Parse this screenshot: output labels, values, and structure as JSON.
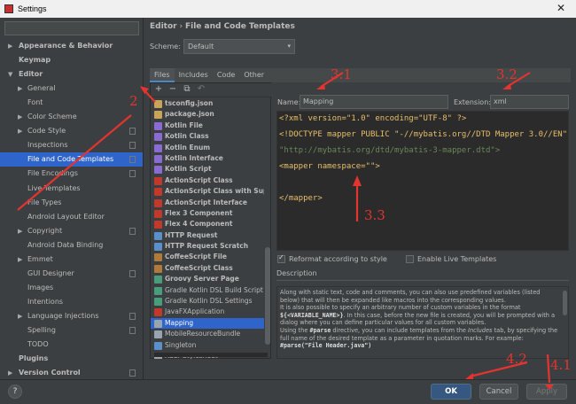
{
  "window": {
    "title": "Settings",
    "close_glyph": "✕"
  },
  "sidebar": {
    "items": [
      {
        "label": "Appearance & Behavior",
        "arrow": "▶",
        "bold": true,
        "indent": 0
      },
      {
        "label": "Keymap",
        "arrow": "",
        "bold": true,
        "indent": 0
      },
      {
        "label": "Editor",
        "arrow": "▼",
        "bold": true,
        "indent": 0
      },
      {
        "label": "General",
        "arrow": "▶",
        "bold": false,
        "indent": 1
      },
      {
        "label": "Font",
        "arrow": "",
        "bold": false,
        "indent": 1
      },
      {
        "label": "Color Scheme",
        "arrow": "▶",
        "bold": false,
        "indent": 1
      },
      {
        "label": "Code Style",
        "arrow": "▶",
        "bold": false,
        "indent": 1,
        "copy": true
      },
      {
        "label": "Inspections",
        "arrow": "",
        "bold": false,
        "indent": 1,
        "copy": true
      },
      {
        "label": "File and Code Templates",
        "arrow": "",
        "bold": false,
        "indent": 1,
        "copy": true,
        "selected": true
      },
      {
        "label": "File Encodings",
        "arrow": "",
        "bold": false,
        "indent": 1,
        "copy": true
      },
      {
        "label": "Live Templates",
        "arrow": "",
        "bold": false,
        "indent": 1
      },
      {
        "label": "File Types",
        "arrow": "",
        "bold": false,
        "indent": 1
      },
      {
        "label": "Android Layout Editor",
        "arrow": "",
        "bold": false,
        "indent": 1
      },
      {
        "label": "Copyright",
        "arrow": "▶",
        "bold": false,
        "indent": 1,
        "copy": true
      },
      {
        "label": "Android Data Binding",
        "arrow": "",
        "bold": false,
        "indent": 1
      },
      {
        "label": "Emmet",
        "arrow": "▶",
        "bold": false,
        "indent": 1
      },
      {
        "label": "GUI Designer",
        "arrow": "",
        "bold": false,
        "indent": 1,
        "copy": true
      },
      {
        "label": "Images",
        "arrow": "",
        "bold": false,
        "indent": 1
      },
      {
        "label": "Intentions",
        "arrow": "",
        "bold": false,
        "indent": 1
      },
      {
        "label": "Language Injections",
        "arrow": "▶",
        "bold": false,
        "indent": 1,
        "copy": true
      },
      {
        "label": "Spelling",
        "arrow": "",
        "bold": false,
        "indent": 1,
        "copy": true
      },
      {
        "label": "TODO",
        "arrow": "",
        "bold": false,
        "indent": 1
      },
      {
        "label": "Plugins",
        "arrow": "",
        "bold": true,
        "indent": 0
      },
      {
        "label": "Version Control",
        "arrow": "▶",
        "bold": true,
        "indent": 0,
        "copy": true
      }
    ]
  },
  "breadcrumb": {
    "root": "Editor",
    "sep": "›",
    "leaf": "File and Code Templates"
  },
  "scheme": {
    "label": "Scheme:",
    "value": "Default",
    "chevron": "▾"
  },
  "tabs": [
    "Files",
    "Includes",
    "Code",
    "Other"
  ],
  "toolbar": {
    "add": "+",
    "remove": "−",
    "copy": "⧉",
    "reset": "↶"
  },
  "templates": [
    {
      "label": "tsconfig.json",
      "bold": true,
      "color": "#c8a35a"
    },
    {
      "label": "package.json",
      "bold": true,
      "color": "#c8a35a"
    },
    {
      "label": "Kotlin File",
      "bold": true,
      "color": "#8a6bd1"
    },
    {
      "label": "Kotlin Class",
      "bold": true,
      "color": "#8a6bd1"
    },
    {
      "label": "Kotlin Enum",
      "bold": true,
      "color": "#8a6bd1"
    },
    {
      "label": "Kotlin Interface",
      "bold": true,
      "color": "#8a6bd1"
    },
    {
      "label": "Kotlin Script",
      "bold": true,
      "color": "#8a6bd1"
    },
    {
      "label": "ActionScript Class",
      "bold": true,
      "color": "#c0392b"
    },
    {
      "label": "ActionScript Class with Supers",
      "bold": true,
      "color": "#c0392b"
    },
    {
      "label": "ActionScript Interface",
      "bold": true,
      "color": "#c0392b"
    },
    {
      "label": "Flex 3 Component",
      "bold": true,
      "color": "#c0392b"
    },
    {
      "label": "Flex 4 Component",
      "bold": true,
      "color": "#c0392b"
    },
    {
      "label": "HTTP Request",
      "bold": true,
      "color": "#5b8fc9"
    },
    {
      "label": "HTTP Request Scratch",
      "bold": true,
      "color": "#5b8fc9"
    },
    {
      "label": "CoffeeScript File",
      "bold": true,
      "color": "#b07a3c"
    },
    {
      "label": "CoffeeScript Class",
      "bold": true,
      "color": "#b07a3c"
    },
    {
      "label": "Groovy Server Page",
      "bold": true,
      "color": "#4a9d7a"
    },
    {
      "label": "Gradle Kotlin DSL Build Script",
      "bold": false,
      "color": "#4a9d7a"
    },
    {
      "label": "Gradle Kotlin DSL Settings",
      "bold": false,
      "color": "#4a9d7a"
    },
    {
      "label": "JavaFXApplication",
      "bold": false,
      "color": "#c0392b"
    },
    {
      "label": "Mapping",
      "bold": false,
      "color": "#9aa4ad",
      "selected": true
    },
    {
      "label": "MobileResourceBundle",
      "bold": false,
      "color": "#9aa4ad"
    },
    {
      "label": "Singleton",
      "bold": false,
      "color": "#5b8fc9"
    },
    {
      "label": "XSLT Stylesheet",
      "bold": false,
      "color": "#9aa4ad"
    }
  ],
  "name_field": {
    "label": "Name:",
    "value": "Mapping"
  },
  "extension_field": {
    "label": "Extension:",
    "value": "xml"
  },
  "code_lines": [
    "<?xml version=\"1.0\" encoding=\"UTF-8\" ?>",
    "<!DOCTYPE mapper PUBLIC \"-//mybatis.org//DTD Mapper 3.0//EN\"",
    "        \"http://mybatis.org/dtd/mybatis-3-mapper.dtd\">",
    "",
    "<mapper namespace=\"\">",
    "",
    "</mapper>"
  ],
  "options": {
    "reformat": {
      "label": "Reformat according to style",
      "checked": true
    },
    "live_templates": {
      "label": "Enable Live Templates",
      "checked": false
    }
  },
  "description": {
    "label": "Description",
    "p1": "Along with static text, code and comments, you can also use predefined variables (listed below) that will then be expanded like macros into the corresponding values.",
    "p2a": "It is also possible to specify an arbitrary number of custom variables in the format ",
    "p2code": "${<VARIABLE_NAME>}",
    "p2b": ". In this case, before the new file is created, you will be prompted with a dialog where you can define particular values for all custom variables.",
    "p3a": "Using the ",
    "p3code": "#parse",
    "p3b": " directive, you can include templates from the ",
    "p3i": "Includes",
    "p3c": " tab, by specifying the full name of the desired template as a parameter in quotation marks. For example:",
    "p4code": "#parse(\"File Header.java\")"
  },
  "buttons": {
    "help": "?",
    "ok": "OK",
    "cancel": "Cancel",
    "apply": "Apply"
  },
  "annotations": [
    "2",
    "3.1",
    "3.2",
    "3.3",
    "4.1",
    "4.2"
  ],
  "colors": {
    "accent": "#2f65ca",
    "annotation": "#e3342f",
    "primary_button": "#365880"
  }
}
